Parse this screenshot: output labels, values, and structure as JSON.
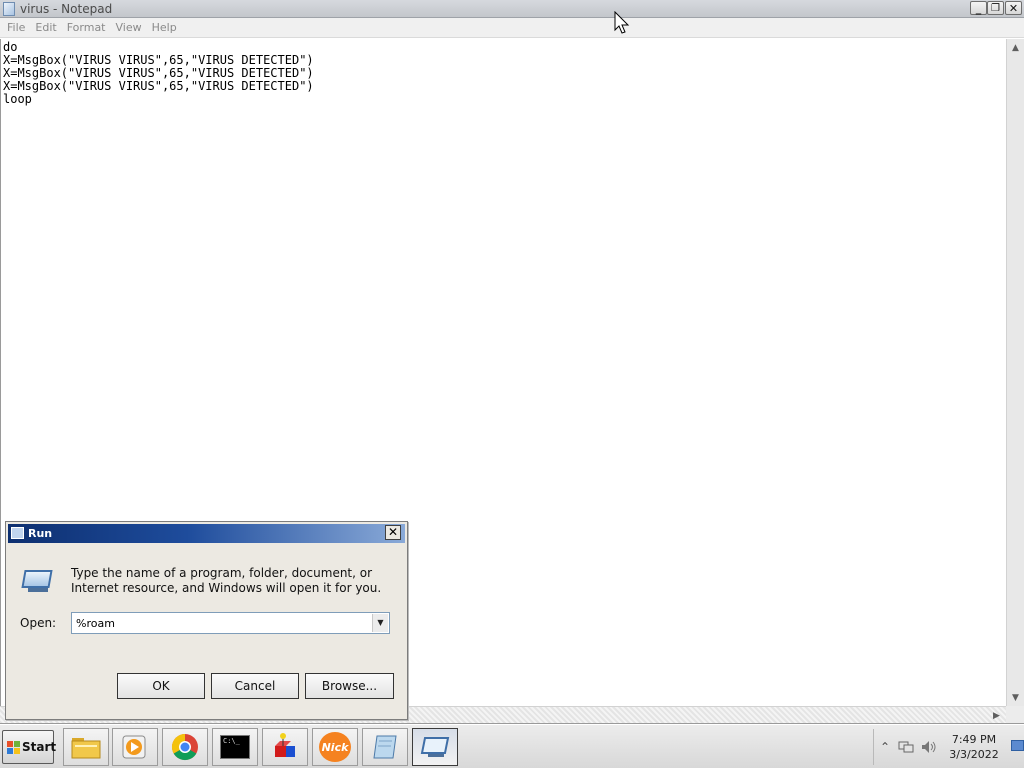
{
  "notepad": {
    "title": "virus - Notepad",
    "menu": [
      "File",
      "Edit",
      "Format",
      "View",
      "Help"
    ],
    "lines": [
      "do",
      "X=MsgBox(\"VIRUS VIRUS\",65,\"VIRUS DETECTED\")",
      "X=MsgBox(\"VIRUS VIRUS\",65,\"VIRUS DETECTED\")",
      "X=MsgBox(\"VIRUS VIRUS\",65,\"VIRUS DETECTED\")",
      "loop"
    ],
    "controls": {
      "minimize": "_",
      "restore": "❐",
      "close": "✕"
    }
  },
  "run_dialog": {
    "title": "Run",
    "description": "Type the name of a program, folder, document, or Internet resource, and Windows will open it for you.",
    "open_label": "Open:",
    "open_value": "%roam",
    "ok_label": "OK",
    "cancel_label": "Cancel",
    "browse_label": "Browse...",
    "close_glyph": "✕"
  },
  "taskbar": {
    "start_label": "Start",
    "items": [
      "file-explorer-icon",
      "media-player-icon",
      "chrome-icon",
      "command-prompt-icon",
      "app-icon",
      "nick-icon",
      "notepad-icon",
      "run-icon"
    ],
    "cmd_text": "C:\\_",
    "nick_text": "Nick",
    "tray_icons": [
      "show-hidden-icons-icon",
      "network-icon",
      "volume-icon"
    ],
    "time": "7:49 PM",
    "date": "3/3/2022"
  }
}
